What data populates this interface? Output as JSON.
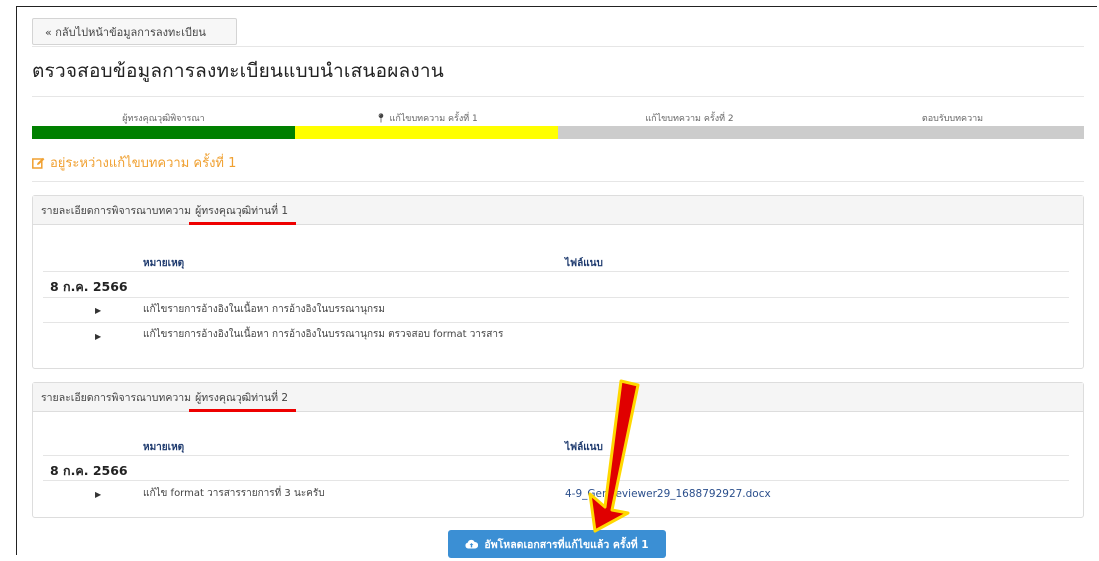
{
  "back_button": {
    "label": "« กลับไปหน้าข้อมูลการลงทะเบียน"
  },
  "page_title": "ตรวจสอบข้อมูลการลงทะเบียนแบบนำเสนอผลงาน",
  "steps": [
    {
      "label": "ผู้ทรงคุณวุฒิพิจารณา",
      "color": "#008000",
      "marker": ""
    },
    {
      "label": "แก้ไขบทความ ครั้งที่ 1",
      "color": "#ffff00",
      "marker": "map-marker-icon"
    },
    {
      "label": "แก้ไขบทความ ครั้งที่ 2",
      "color": "#cccccc",
      "marker": ""
    },
    {
      "label": "ตอบรับบทความ",
      "color": "#cccccc",
      "marker": ""
    }
  ],
  "status": {
    "icon": "edit-icon",
    "text": "อยู่ระหว่างแก้ไขบทความ ครั้งที่ 1",
    "color": "#f0a030"
  },
  "panels": [
    {
      "title_prefix": "รายละเอียดการพิจารณาบทความ",
      "reviewer": "ผู้ทรงคุณวุฒิท่านที่ 1",
      "col_note": "หมายเหตุ",
      "col_file": "ไฟล์แนบ",
      "date": "8 ก.ค. 2566",
      "items": [
        {
          "text": "แก้ไขรายการอ้างอิงในเนื้อหา การอ้างอิงในบรรณานุกรม",
          "file": ""
        },
        {
          "text": "แก้ไขรายการอ้างอิงในเนื้อหา การอ้างอิงในบรรณานุกรม ตรวจสอบ format วารสาร",
          "file": ""
        }
      ]
    },
    {
      "title_prefix": "รายละเอียดการพิจารณาบทความ",
      "reviewer": "ผู้ทรงคุณวุฒิท่านที่ 2",
      "col_note": "หมายเหตุ",
      "col_file": "ไฟล์แนบ",
      "date": "8 ก.ค. 2566",
      "items": [
        {
          "text": "แก้ไข format วารสารรายการที่ 3 นะครับ",
          "file": "4-9_GenReviewer29_1688792927.docx"
        }
      ]
    }
  ],
  "upload_button": {
    "icon": "cloud-upload-icon",
    "label": "อัพโหลดเอกสารที่แก้ไขแล้ว ครั้งที่ 1"
  },
  "annotation_colors": {
    "underline": "#e00000",
    "arrow_fill": "#e00000",
    "arrow_outline": "#ffd800"
  }
}
